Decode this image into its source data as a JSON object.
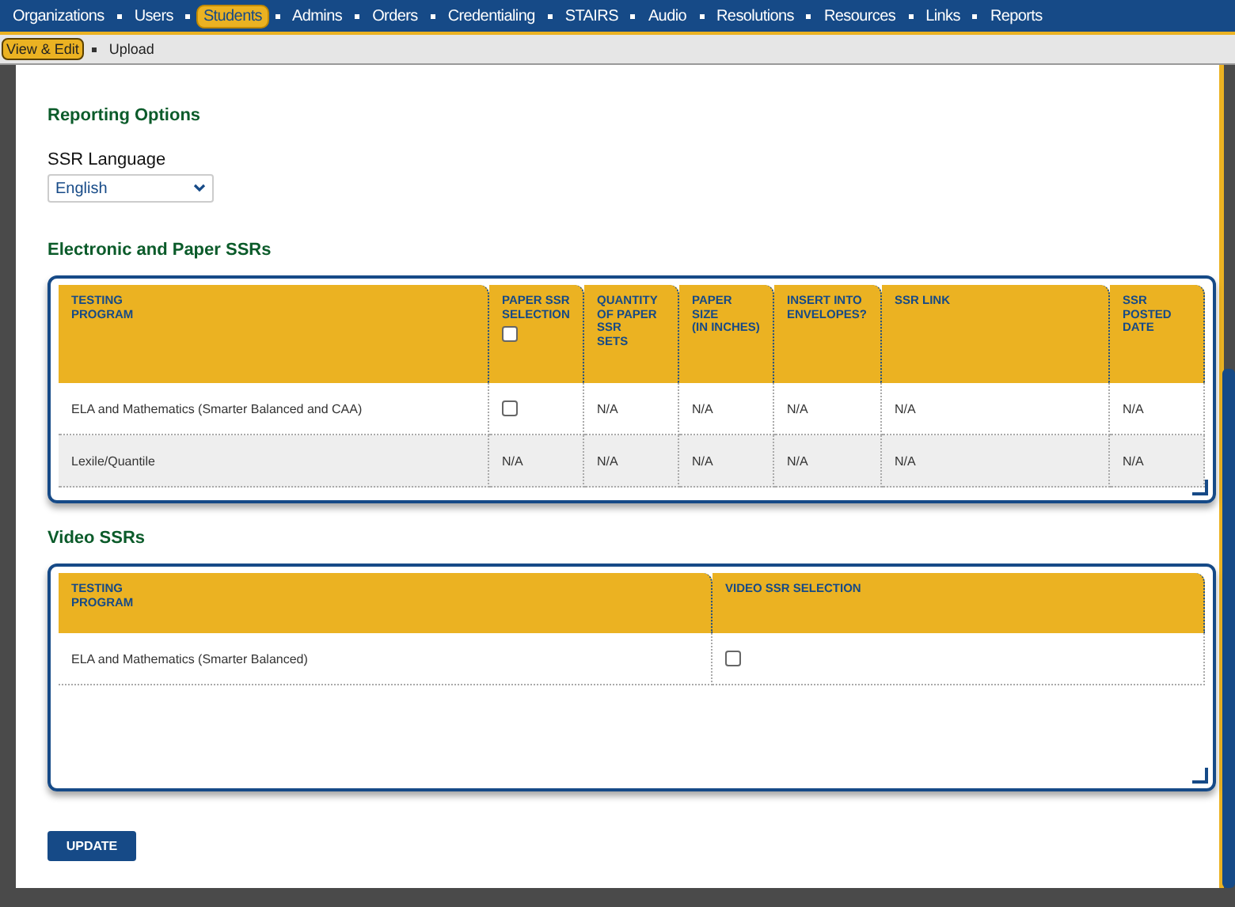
{
  "nav": [
    {
      "label": "Organizations",
      "selected": false
    },
    {
      "label": "Users",
      "selected": false
    },
    {
      "label": "Students",
      "selected": true
    },
    {
      "label": "Admins",
      "selected": false
    },
    {
      "label": "Orders",
      "selected": false
    },
    {
      "label": "Credentialing",
      "selected": false
    },
    {
      "label": "STAIRS",
      "selected": false
    },
    {
      "label": "Audio",
      "selected": false
    },
    {
      "label": "Resolutions",
      "selected": false
    },
    {
      "label": "Resources",
      "selected": false
    },
    {
      "label": "Links",
      "selected": false
    },
    {
      "label": "Reports",
      "selected": false
    }
  ],
  "subnav": [
    {
      "label": "View & Edit",
      "selected": true
    },
    {
      "label": "Upload",
      "selected": false
    }
  ],
  "reporting": {
    "title": "Reporting Options",
    "language_label": "SSR Language",
    "language_value": "English"
  },
  "tables": [
    {
      "title": "Electronic and Paper SSRs",
      "columns": [
        {
          "label": "TESTING\nPROGRAM",
          "kind": "text"
        },
        {
          "label": "PAPER SSR\nSELECTION",
          "kind": "checkbox",
          "checked": false
        },
        {
          "label": "QUANTITY\nOF PAPER\nSSR\nSETS",
          "kind": "text"
        },
        {
          "label": "PAPER\nSIZE\n(IN INCHES)",
          "kind": "text"
        },
        {
          "label": "INSERT INTO\nENVELOPES?",
          "kind": "text"
        },
        {
          "label": "SSR LINK",
          "kind": "text"
        },
        {
          "label": "SSR\nPOSTED\nDATE",
          "kind": "text"
        }
      ],
      "rows": [
        [
          {
            "kind": "text",
            "text": "ELA and Mathematics (Smarter Balanced and CAA)"
          },
          {
            "kind": "checkbox",
            "checked": false
          },
          {
            "kind": "text",
            "text": "N/A"
          },
          {
            "kind": "text",
            "text": "N/A"
          },
          {
            "kind": "text",
            "text": "N/A"
          },
          {
            "kind": "text",
            "text": "N/A"
          },
          {
            "kind": "text",
            "text": "N/A"
          }
        ],
        [
          {
            "kind": "text",
            "text": "Lexile/Quantile"
          },
          {
            "kind": "text",
            "text": "N/A"
          },
          {
            "kind": "text",
            "text": "N/A"
          },
          {
            "kind": "text",
            "text": "N/A"
          },
          {
            "kind": "text",
            "text": "N/A"
          },
          {
            "kind": "text",
            "text": "N/A"
          },
          {
            "kind": "text",
            "text": "N/A"
          }
        ]
      ]
    },
    {
      "title": "Video SSRs",
      "columns": [
        {
          "label": "TESTING\nPROGRAM",
          "kind": "text"
        },
        {
          "label": "VIDEO SSR SELECTION",
          "kind": "text"
        }
      ],
      "rows": [
        [
          {
            "kind": "text",
            "text": "ELA and Mathematics (Smarter Balanced)"
          },
          {
            "kind": "checkbox",
            "checked": false
          }
        ]
      ]
    }
  ],
  "update_button": "UPDATE"
}
